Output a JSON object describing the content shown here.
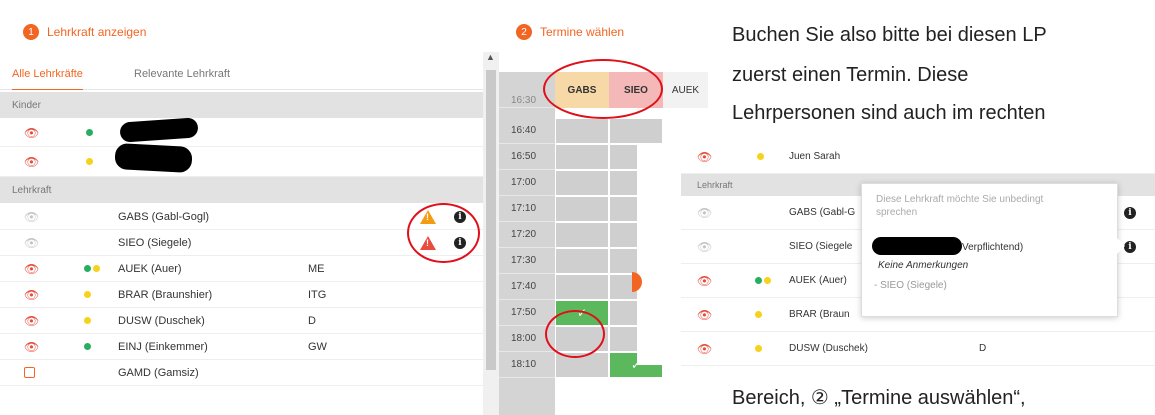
{
  "colors": {
    "accent": "#f26522",
    "eye_active": "#e74c3c",
    "eye_inactive": "#9e9e9e",
    "dot_green": "#27ae60",
    "dot_yellow": "#f6d21a",
    "warn_orange": "#f39c12",
    "warn_red": "#e74c3c",
    "col_gabs": "#f7d9a8",
    "col_sieo": "#f4b8b8",
    "slot_grey": "#cfcfcf",
    "slot_green": "#5cb85c",
    "highlight_ring": "#e0101a"
  },
  "step1": {
    "number": "1",
    "title": "Lehrkraft anzeigen"
  },
  "step2": {
    "number": "2",
    "title": "Termine wählen"
  },
  "tabs": [
    {
      "label": "Alle Lehrkräfte",
      "active": true
    },
    {
      "label": "Relevante Lehrkraft",
      "active": false
    }
  ],
  "sections": {
    "kinder": "Kinder",
    "lehrkraft": "Lehrkraft"
  },
  "teachers": [
    {
      "name": "GABS (Gabl-Gogl)",
      "subject": "",
      "eye": "inactive",
      "dots": [],
      "warning": "orange",
      "info": true
    },
    {
      "name": "SIEO (Siegele)",
      "subject": "",
      "eye": "inactive",
      "dots": [],
      "warning": "red",
      "info": true
    },
    {
      "name": "AUEK (Auer)",
      "subject": "ME",
      "eye": "active",
      "dots": [
        "green",
        "yellow"
      ],
      "warning": "",
      "info": false
    },
    {
      "name": "BRAR (Braunshier)",
      "subject": "ITG",
      "eye": "active",
      "dots": [
        "yellow"
      ],
      "warning": "",
      "info": false
    },
    {
      "name": "DUSW (Duschek)",
      "subject": "D",
      "eye": "active",
      "dots": [
        "yellow"
      ],
      "warning": "",
      "info": false
    },
    {
      "name": "EINJ (Einkemmer)",
      "subject": "GW",
      "eye": "active",
      "dots": [
        "green"
      ],
      "warning": "",
      "info": false
    },
    {
      "name": "GAMD (Gamsiz)",
      "subject": "",
      "eye": "checkbox",
      "dots": [],
      "warning": "",
      "info": false
    }
  ],
  "schedule": {
    "columns": [
      "GABS",
      "SIEO",
      "AUEK"
    ],
    "top_time_partial": "16:30",
    "times": [
      "16:40",
      "16:50",
      "17:00",
      "17:10",
      "17:20",
      "17:30",
      "17:40",
      "17:50",
      "18:00",
      "18:10"
    ]
  },
  "overlay": {
    "top_name": "Juen Sarah",
    "section": "Lehrkraft",
    "rows": [
      {
        "name": "GABS (Gabl-G",
        "eye": "inactive",
        "dots": [],
        "info": true
      },
      {
        "name": "SIEO (Siegele",
        "eye": "inactive",
        "dots": [],
        "info": true
      },
      {
        "name": "AUEK (Auer)",
        "eye": "active",
        "dots": [
          "green",
          "yellow"
        ],
        "info": false
      },
      {
        "name": "BRAR (Braun",
        "eye": "active",
        "dots": [
          "yellow"
        ],
        "info": false
      },
      {
        "name": "DUSW (Duschek)",
        "subject": "D",
        "eye": "active",
        "dots": [
          "yellow"
        ],
        "info": false
      }
    ],
    "tooltip": {
      "line1": "Diese Lehrkraft möchte Sie unbedingt",
      "line2": "sprechen",
      "obligation": "Verpflichtend)",
      "remarks": "Keine Anmerkungen",
      "teacher": "- SIEO (Siegele)"
    }
  },
  "right_text": {
    "line1": "Buchen Sie also bitte bei diesen LP",
    "line2": "zuerst einen Termin. Diese",
    "line3": "Lehrpersonen sind auch im rechten",
    "line4": "Bereich, ② „Termine auswählen“,"
  }
}
